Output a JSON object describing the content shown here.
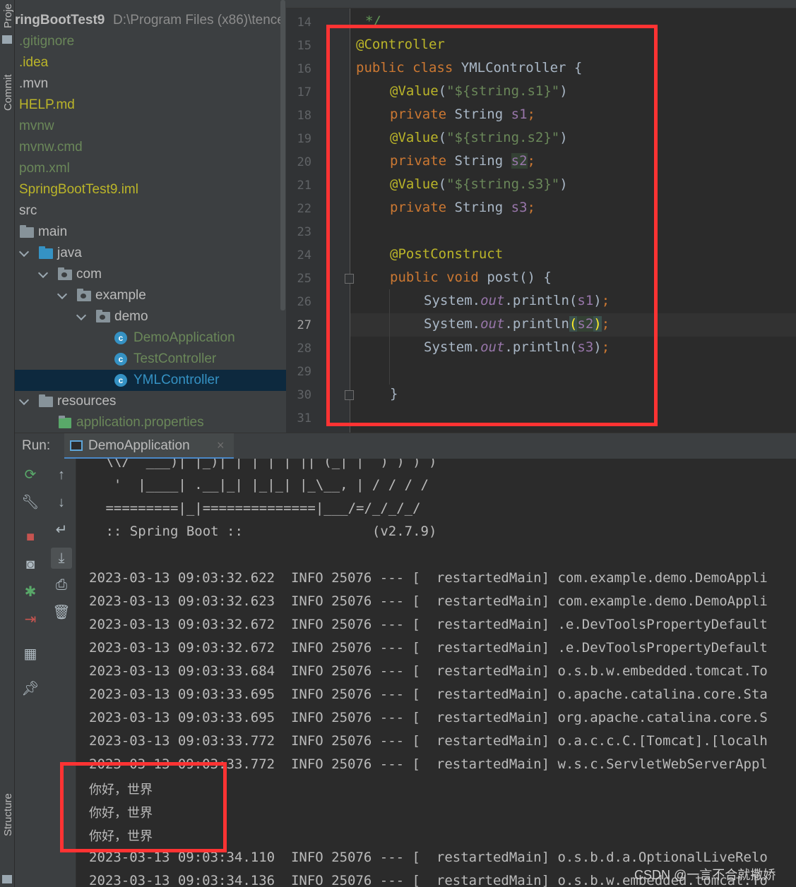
{
  "sidebar": {
    "project_tab": "Proje",
    "commit_tab": "Commit",
    "structure_tab": "Structure"
  },
  "project_tree": {
    "root_name": "ringBootTest9",
    "root_path": "D:\\Program Files (x86)\\tence",
    "items": [
      {
        "label": ".gitignore",
        "color": "#6a8759"
      },
      {
        "label": ".idea",
        "color": "#bbb529"
      },
      {
        "label": ".mvn",
        "color": "#bbbbbb"
      },
      {
        "label": "HELP.md",
        "color": "#bbb529"
      },
      {
        "label": "mvnw",
        "color": "#6a8759"
      },
      {
        "label": "mvnw.cmd",
        "color": "#6a8759"
      },
      {
        "label": "pom.xml",
        "color": "#6a8759"
      },
      {
        "label": "SpringBootTest9.iml",
        "color": "#bbb529"
      },
      {
        "label": "src",
        "color": "#bbbbbb"
      },
      {
        "label": "main",
        "color": "#bbbbbb"
      },
      {
        "label": "java",
        "color": "#bbbbbb"
      },
      {
        "label": "com",
        "color": "#bbbbbb"
      },
      {
        "label": "example",
        "color": "#bbbbbb"
      },
      {
        "label": "demo",
        "color": "#bbbbbb"
      },
      {
        "label": "DemoApplication",
        "color": "#6a8759"
      },
      {
        "label": "TestController",
        "color": "#6a8759"
      },
      {
        "label": "YMLController",
        "color": "#3592c4"
      },
      {
        "label": "resources",
        "color": "#bbbbbb"
      },
      {
        "label": "application.properties",
        "color": "#6a8759"
      }
    ]
  },
  "editor": {
    "line_numbers": [
      "14",
      "15",
      "16",
      "17",
      "18",
      "19",
      "20",
      "21",
      "22",
      "23",
      "24",
      "25",
      "26",
      "27",
      "28",
      "29",
      "30",
      "31"
    ],
    "current_line": "27",
    "tokens": {
      "comment_end": "*/",
      "controller_ann": "@Controller",
      "public": "public",
      "class": "class",
      "class_name": "YMLController",
      "open_brace": "{",
      "value_ann": "@Value",
      "s1_str": "\"${string.s1}\"",
      "s2_str": "\"${string.s2}\"",
      "s3_str": "\"${string.s3}\"",
      "private": "private",
      "string_type": "String",
      "s1": "s1",
      "s2": "s2",
      "s3": "s3",
      "semi": ";",
      "postconstruct_ann": "@PostConstruct",
      "void": "void",
      "post_method": "post()",
      "system": "System.",
      "out": "out",
      "println": ".println",
      "lparen": "(",
      "rparen": ")",
      "close_brace": "}"
    }
  },
  "run_panel": {
    "label": "Run:",
    "tab_name": "DemoApplication",
    "close_glyph": "×",
    "console_lines": [
      " \\\\/  ___)| |_)| | | | | || (_| |  ) ) ) )",
      "  '  |____| .__|_| |_|_| |_\\__, | / / / /",
      " =========|_|==============|___/=/_/_/_/",
      " :: Spring Boot ::                (v2.7.9)",
      "2023-03-13 09:03:32.622  INFO 25076 --- [  restartedMain] com.example.demo.DemoAppli",
      "2023-03-13 09:03:32.623  INFO 25076 --- [  restartedMain] com.example.demo.DemoAppli",
      "2023-03-13 09:03:32.672  INFO 25076 --- [  restartedMain] .e.DevToolsPropertyDefault",
      "2023-03-13 09:03:32.672  INFO 25076 --- [  restartedMain] .e.DevToolsPropertyDefault",
      "2023-03-13 09:03:33.684  INFO 25076 --- [  restartedMain] o.s.b.w.embedded.tomcat.To",
      "2023-03-13 09:03:33.695  INFO 25076 --- [  restartedMain] o.apache.catalina.core.Sta",
      "2023-03-13 09:03:33.695  INFO 25076 --- [  restartedMain] org.apache.catalina.core.S",
      "2023-03-13 09:03:33.772  INFO 25076 --- [  restartedMain] o.a.c.c.C.[Tomcat].[localh",
      "2023-03-13 09:03:33.772  INFO 25076 --- [  restartedMain] w.s.c.ServletWebServerAppl",
      "2023-03-13 09:03:34.110  INFO 25076 --- [  restartedMain] o.s.b.d.a.OptionalLiveRelo",
      "2023-03-13 09:03:34.136  INFO 25076 --- [  restartedMain] o.s.b.w.embedded.tomcat.To"
    ],
    "output_lines": [
      "你好，世界",
      "你好，世界",
      "你好，世界"
    ]
  },
  "watermark": "CSDN @一言不合就撒娇",
  "colors": {
    "highlight_box": "#ff3333",
    "selection": "#0d293e",
    "accent": "#4a88c7"
  }
}
